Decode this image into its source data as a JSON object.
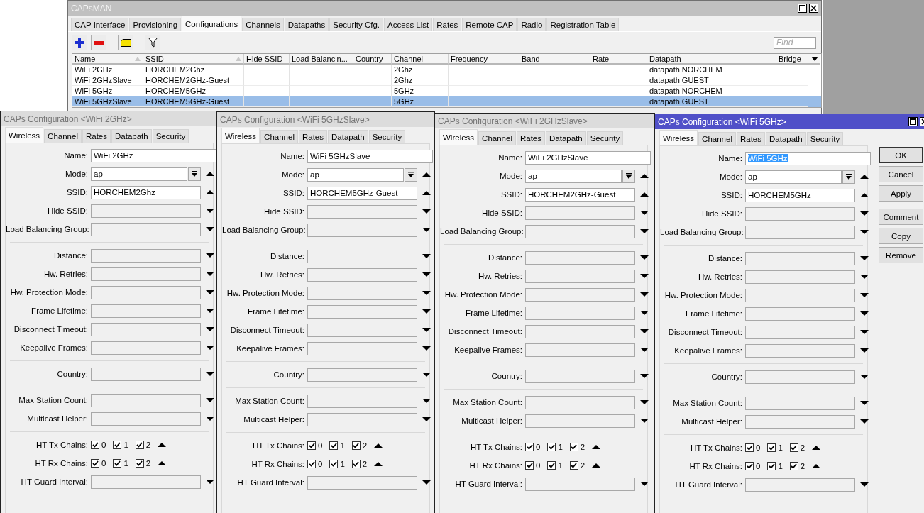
{
  "main_window": {
    "title": "CAPsMAN",
    "tabs": [
      {
        "label": "CAP Interface",
        "selected": false
      },
      {
        "label": "Provisioning",
        "selected": false
      },
      {
        "label": "Configurations",
        "selected": true
      },
      {
        "label": "Channels",
        "selected": false
      },
      {
        "label": "Datapaths",
        "selected": false
      },
      {
        "label": "Security Cfg.",
        "selected": false
      },
      {
        "label": "Access List",
        "selected": false
      },
      {
        "label": "Rates",
        "selected": false
      },
      {
        "label": "Remote CAP",
        "selected": false
      },
      {
        "label": "Radio",
        "selected": false
      },
      {
        "label": "Registration Table",
        "selected": false
      }
    ],
    "find": {
      "placeholder": "Find"
    },
    "table": {
      "columns": [
        {
          "label": "Name",
          "sorted": true
        },
        {
          "label": "SSID",
          "sorted": true
        },
        {
          "label": "Hide SSID",
          "sorted": false
        },
        {
          "label": "Load Balancin...",
          "sorted": false
        },
        {
          "label": "Country",
          "sorted": false
        },
        {
          "label": "Channel",
          "sorted": false
        },
        {
          "label": "Frequency",
          "sorted": false
        },
        {
          "label": "Band",
          "sorted": false
        },
        {
          "label": "Rate",
          "sorted": false
        },
        {
          "label": "Datapath",
          "sorted": false
        },
        {
          "label": "Bridge",
          "sorted": false
        }
      ],
      "rows": [
        {
          "name": "WiFi 2GHz",
          "ssid": "HORCHEM2Ghz",
          "channel": "2Ghz",
          "datapath": "datapath NORCHEM",
          "selected": false
        },
        {
          "name": "WiFi 2GHzSlave",
          "ssid": "HORCHEM2GHz-Guest",
          "channel": "2Ghz",
          "datapath": "datapath GUEST",
          "selected": false
        },
        {
          "name": "WiFi 5GHz",
          "ssid": "HORCHEM5GHz",
          "channel": "5GHz",
          "datapath": "datapath NORCHEM",
          "selected": false
        },
        {
          "name": "WiFi 5GHzSlave",
          "ssid": "HORCHEM5GHz-Guest",
          "channel": "5GHz",
          "datapath": "datapath GUEST",
          "selected": true
        }
      ]
    }
  },
  "config_windows": [
    {
      "title": "CAPs Configuration <WiFi 2GHz>",
      "active": false,
      "tabs": [
        {
          "label": "Wireless",
          "selected": true
        },
        {
          "label": "Channel",
          "selected": false
        },
        {
          "label": "Rates",
          "selected": false
        },
        {
          "label": "Datapath",
          "selected": false
        },
        {
          "label": "Security",
          "selected": false
        }
      ],
      "groups": [
        [
          {
            "label": "Name:",
            "kind": "name",
            "value": "WiFi 2GHz",
            "text_selected": false
          },
          {
            "label": "Mode:",
            "kind": "combo",
            "value": "ap"
          },
          {
            "label": "SSID:",
            "kind": "ssid",
            "value": "HORCHEM2Ghz"
          },
          {
            "label": "Hide SSID:",
            "kind": "empty"
          },
          {
            "label": "Load Balancing Group:",
            "kind": "empty"
          }
        ],
        [
          {
            "label": "Distance:",
            "kind": "empty"
          },
          {
            "label": "Hw. Retries:",
            "kind": "empty"
          },
          {
            "label": "Hw. Protection Mode:",
            "kind": "empty"
          },
          {
            "label": "Frame Lifetime:",
            "kind": "empty"
          },
          {
            "label": "Disconnect Timeout:",
            "kind": "empty"
          },
          {
            "label": "Keepalive Frames:",
            "kind": "empty"
          }
        ],
        [
          {
            "label": "Country:",
            "kind": "empty"
          }
        ],
        [
          {
            "label": "Max Station Count:",
            "kind": "empty"
          },
          {
            "label": "Multicast Helper:",
            "kind": "empty"
          }
        ],
        [
          {
            "label": "HT Tx Chains:",
            "kind": "chains",
            "chains": [
              {
                "label": "0",
                "checked": true
              },
              {
                "label": "1",
                "checked": true
              },
              {
                "label": "2",
                "checked": true
              }
            ]
          },
          {
            "label": "HT Rx Chains:",
            "kind": "chains",
            "chains": [
              {
                "label": "0",
                "checked": true
              },
              {
                "label": "1",
                "checked": true
              },
              {
                "label": "2",
                "checked": true
              }
            ]
          },
          {
            "label": "HT Guard Interval:",
            "kind": "empty"
          }
        ]
      ]
    },
    {
      "title": "CAPs Configuration <WiFi 5GHzSlave>",
      "active": false,
      "tabs": [
        {
          "label": "Wireless",
          "selected": true
        },
        {
          "label": "Channel",
          "selected": false
        },
        {
          "label": "Rates",
          "selected": false
        },
        {
          "label": "Datapath",
          "selected": false
        },
        {
          "label": "Security",
          "selected": false
        }
      ],
      "groups": [
        [
          {
            "label": "Name:",
            "kind": "name",
            "value": "WiFi 5GHzSlave",
            "text_selected": false
          },
          {
            "label": "Mode:",
            "kind": "combo",
            "value": "ap"
          },
          {
            "label": "SSID:",
            "kind": "ssid",
            "value": "HORCHEM5GHz-Guest"
          },
          {
            "label": "Hide SSID:",
            "kind": "empty"
          },
          {
            "label": "Load Balancing Group:",
            "kind": "empty"
          }
        ],
        [
          {
            "label": "Distance:",
            "kind": "empty"
          },
          {
            "label": "Hw. Retries:",
            "kind": "empty"
          },
          {
            "label": "Hw. Protection Mode:",
            "kind": "empty"
          },
          {
            "label": "Frame Lifetime:",
            "kind": "empty"
          },
          {
            "label": "Disconnect Timeout:",
            "kind": "empty"
          },
          {
            "label": "Keepalive Frames:",
            "kind": "empty"
          }
        ],
        [
          {
            "label": "Country:",
            "kind": "empty"
          }
        ],
        [
          {
            "label": "Max Station Count:",
            "kind": "empty"
          },
          {
            "label": "Multicast Helper:",
            "kind": "empty"
          }
        ],
        [
          {
            "label": "HT Tx Chains:",
            "kind": "chains",
            "chains": [
              {
                "label": "0",
                "checked": true
              },
              {
                "label": "1",
                "checked": true
              },
              {
                "label": "2",
                "checked": true
              }
            ]
          },
          {
            "label": "HT Rx Chains:",
            "kind": "chains",
            "chains": [
              {
                "label": "0",
                "checked": true
              },
              {
                "label": "1",
                "checked": true
              },
              {
                "label": "2",
                "checked": true
              }
            ]
          },
          {
            "label": "HT Guard Interval:",
            "kind": "empty"
          }
        ]
      ]
    },
    {
      "title": "CAPs Configuration <WiFi 2GHzSlave>",
      "active": false,
      "tabs": [
        {
          "label": "Wireless",
          "selected": true
        },
        {
          "label": "Channel",
          "selected": false
        },
        {
          "label": "Rates",
          "selected": false
        },
        {
          "label": "Datapath",
          "selected": false
        },
        {
          "label": "Security",
          "selected": false
        }
      ],
      "groups": [
        [
          {
            "label": "Name:",
            "kind": "name",
            "value": "WiFi 2GHzSlave",
            "text_selected": false
          },
          {
            "label": "Mode:",
            "kind": "combo",
            "value": "ap"
          },
          {
            "label": "SSID:",
            "kind": "ssid",
            "value": "HORCHEM2GHz-Guest"
          },
          {
            "label": "Hide SSID:",
            "kind": "empty"
          },
          {
            "label": "Load Balancing Group:",
            "kind": "empty"
          }
        ],
        [
          {
            "label": "Distance:",
            "kind": "empty"
          },
          {
            "label": "Hw. Retries:",
            "kind": "empty"
          },
          {
            "label": "Hw. Protection Mode:",
            "kind": "empty"
          },
          {
            "label": "Frame Lifetime:",
            "kind": "empty"
          },
          {
            "label": "Disconnect Timeout:",
            "kind": "empty"
          },
          {
            "label": "Keepalive Frames:",
            "kind": "empty"
          }
        ],
        [
          {
            "label": "Country:",
            "kind": "empty"
          }
        ],
        [
          {
            "label": "Max Station Count:",
            "kind": "empty"
          },
          {
            "label": "Multicast Helper:",
            "kind": "empty"
          }
        ],
        [
          {
            "label": "HT Tx Chains:",
            "kind": "chains",
            "chains": [
              {
                "label": "0",
                "checked": true
              },
              {
                "label": "1",
                "checked": true
              },
              {
                "label": "2",
                "checked": true
              }
            ]
          },
          {
            "label": "HT Rx Chains:",
            "kind": "chains",
            "chains": [
              {
                "label": "0",
                "checked": true
              },
              {
                "label": "1",
                "checked": true
              },
              {
                "label": "2",
                "checked": true
              }
            ]
          },
          {
            "label": "HT Guard Interval:",
            "kind": "empty"
          }
        ]
      ]
    },
    {
      "title": "CAPs Configuration <WiFi 5GHz>",
      "active": true,
      "tabs": [
        {
          "label": "Wireless",
          "selected": true
        },
        {
          "label": "Channel",
          "selected": false
        },
        {
          "label": "Rates",
          "selected": false
        },
        {
          "label": "Datapath",
          "selected": false
        },
        {
          "label": "Security",
          "selected": false
        }
      ],
      "groups": [
        [
          {
            "label": "Name:",
            "kind": "name",
            "value": "WiFi 5GHz",
            "text_selected": true
          },
          {
            "label": "Mode:",
            "kind": "combo",
            "value": "ap"
          },
          {
            "label": "SSID:",
            "kind": "ssid",
            "value": "HORCHEM5GHz"
          },
          {
            "label": "Hide SSID:",
            "kind": "empty"
          },
          {
            "label": "Load Balancing Group:",
            "kind": "empty"
          }
        ],
        [
          {
            "label": "Distance:",
            "kind": "empty"
          },
          {
            "label": "Hw. Retries:",
            "kind": "empty"
          },
          {
            "label": "Hw. Protection Mode:",
            "kind": "empty"
          },
          {
            "label": "Frame Lifetime:",
            "kind": "empty"
          },
          {
            "label": "Disconnect Timeout:",
            "kind": "empty"
          },
          {
            "label": "Keepalive Frames:",
            "kind": "empty"
          }
        ],
        [
          {
            "label": "Country:",
            "kind": "empty"
          }
        ],
        [
          {
            "label": "Max Station Count:",
            "kind": "empty"
          },
          {
            "label": "Multicast Helper:",
            "kind": "empty"
          }
        ],
        [
          {
            "label": "HT Tx Chains:",
            "kind": "chains",
            "chains": [
              {
                "label": "0",
                "checked": true
              },
              {
                "label": "1",
                "checked": true
              },
              {
                "label": "2",
                "checked": true
              }
            ]
          },
          {
            "label": "HT Rx Chains:",
            "kind": "chains",
            "chains": [
              {
                "label": "0",
                "checked": true
              },
              {
                "label": "1",
                "checked": true
              },
              {
                "label": "2",
                "checked": true
              }
            ]
          },
          {
            "label": "HT Guard Interval:",
            "kind": "empty"
          }
        ]
      ],
      "buttons": [
        "OK",
        "Cancel",
        "Apply",
        "Comment",
        "Copy",
        "Remove"
      ]
    }
  ]
}
